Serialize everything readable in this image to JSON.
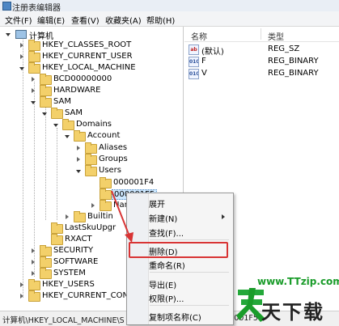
{
  "window": {
    "title": "注册表编辑器"
  },
  "menubar": [
    {
      "label": "文件(F)"
    },
    {
      "label": "编辑(E)"
    },
    {
      "label": "查看(V)"
    },
    {
      "label": "收藏夹(A)"
    },
    {
      "label": "帮助(H)"
    }
  ],
  "tree": {
    "computer": "计算机",
    "hkcr": "HKEY_CLASSES_ROOT",
    "hkcu": "HKEY_CURRENT_USER",
    "hklm": "HKEY_LOCAL_MACHINE",
    "bcd": "BCD00000000",
    "hardware": "HARDWARE",
    "sam": "SAM",
    "sam2": "SAM",
    "domains": "Domains",
    "account": "Account",
    "aliases": "Aliases",
    "groups": "Groups",
    "users": "Users",
    "u1f4": "000001F4",
    "u1f5": "000001F5",
    "names": "Nam",
    "builtin": "Builtin",
    "lastsku": "LastSkuUpgr",
    "rxact": "RXACT",
    "security": "SECURITY",
    "software": "SOFTWARE",
    "system": "SYSTEM",
    "hku": "HKEY_USERS",
    "hkcc": "HKEY_CURRENT_CONFI"
  },
  "list": {
    "col_name": "名称",
    "col_type": "类型",
    "rows": [
      {
        "icon": "ab",
        "name": "(默认)",
        "type": "REG_SZ"
      },
      {
        "icon": "010",
        "name": "F",
        "type": "REG_BINARY"
      },
      {
        "icon": "010",
        "name": "V",
        "type": "REG_BINARY"
      }
    ]
  },
  "context_menu": {
    "expand": "展开",
    "new": "新建(N)",
    "find": "查找(F)...",
    "delete": "删除(D)",
    "rename": "重命名(R)",
    "export": "导出(E)",
    "permissions": "权限(P)...",
    "copy_key": "复制项名称(C)"
  },
  "statusbar": {
    "path_left": "计算机\\HKEY_LOCAL_MACHINE\\SAM",
    "path_right": "s\\000001F5"
  },
  "watermark": {
    "url": "www.TTzip.com",
    "text": "天下载"
  },
  "colors": {
    "highlight_red": "#d83434",
    "selection_blue": "#cde8ff",
    "watermark_green": "#1a9c2a"
  }
}
